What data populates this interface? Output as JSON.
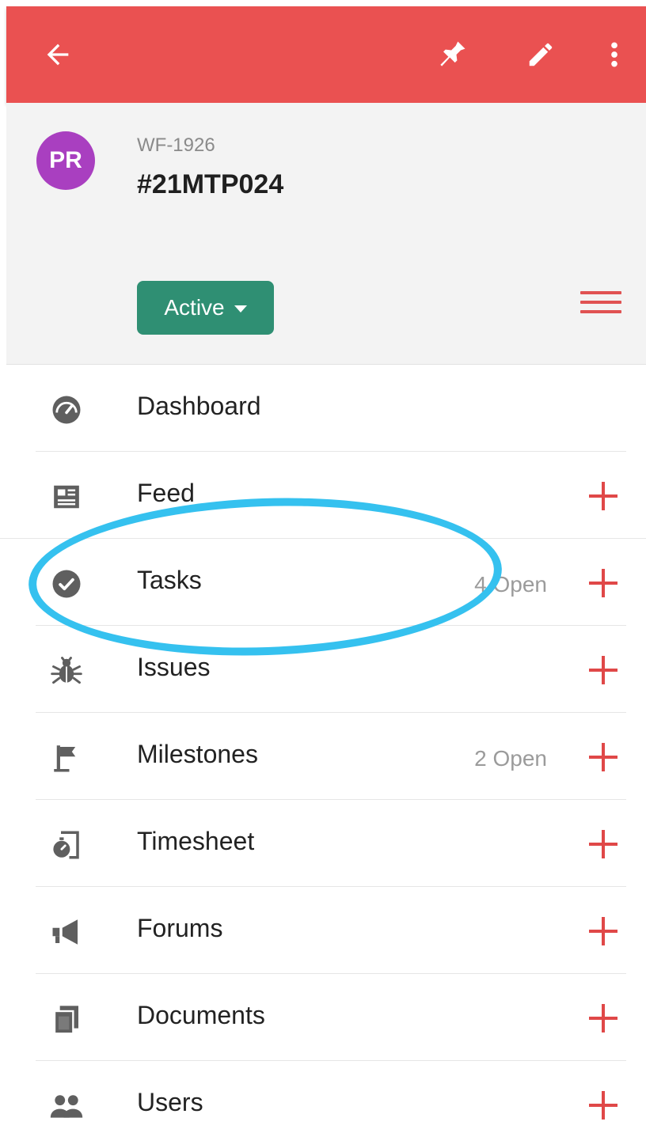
{
  "header": {
    "avatar_initials": "PR",
    "project_code": "WF-1926",
    "project_title": "#21MTP024",
    "status_label": "Active"
  },
  "icons": {
    "back": "back-arrow-icon",
    "pin": "pin-icon",
    "edit": "pencil-icon",
    "more": "more-vertical-icon",
    "menu": "hamburger-icon"
  },
  "colors": {
    "appbar": "#ea5151",
    "avatar": "#a93fc0",
    "status": "#2f8f73",
    "accent": "#e04848",
    "highlight": "#35c1ef"
  },
  "menu_items": [
    {
      "label": "Dashboard",
      "count": "",
      "icon": "speedometer-icon"
    },
    {
      "label": "Feed",
      "count": "",
      "icon": "newspaper-icon"
    },
    {
      "label": "Tasks",
      "count": "4 Open",
      "icon": "check-circle-icon"
    },
    {
      "label": "Issues",
      "count": "",
      "icon": "bug-icon"
    },
    {
      "label": "Milestones",
      "count": "2 Open",
      "icon": "flag-icon"
    },
    {
      "label": "Timesheet",
      "count": "",
      "icon": "timer-icon"
    },
    {
      "label": "Forums",
      "count": "",
      "icon": "megaphone-icon"
    },
    {
      "label": "Documents",
      "count": "",
      "icon": "documents-icon"
    },
    {
      "label": "Users",
      "count": "",
      "icon": "users-icon"
    }
  ]
}
